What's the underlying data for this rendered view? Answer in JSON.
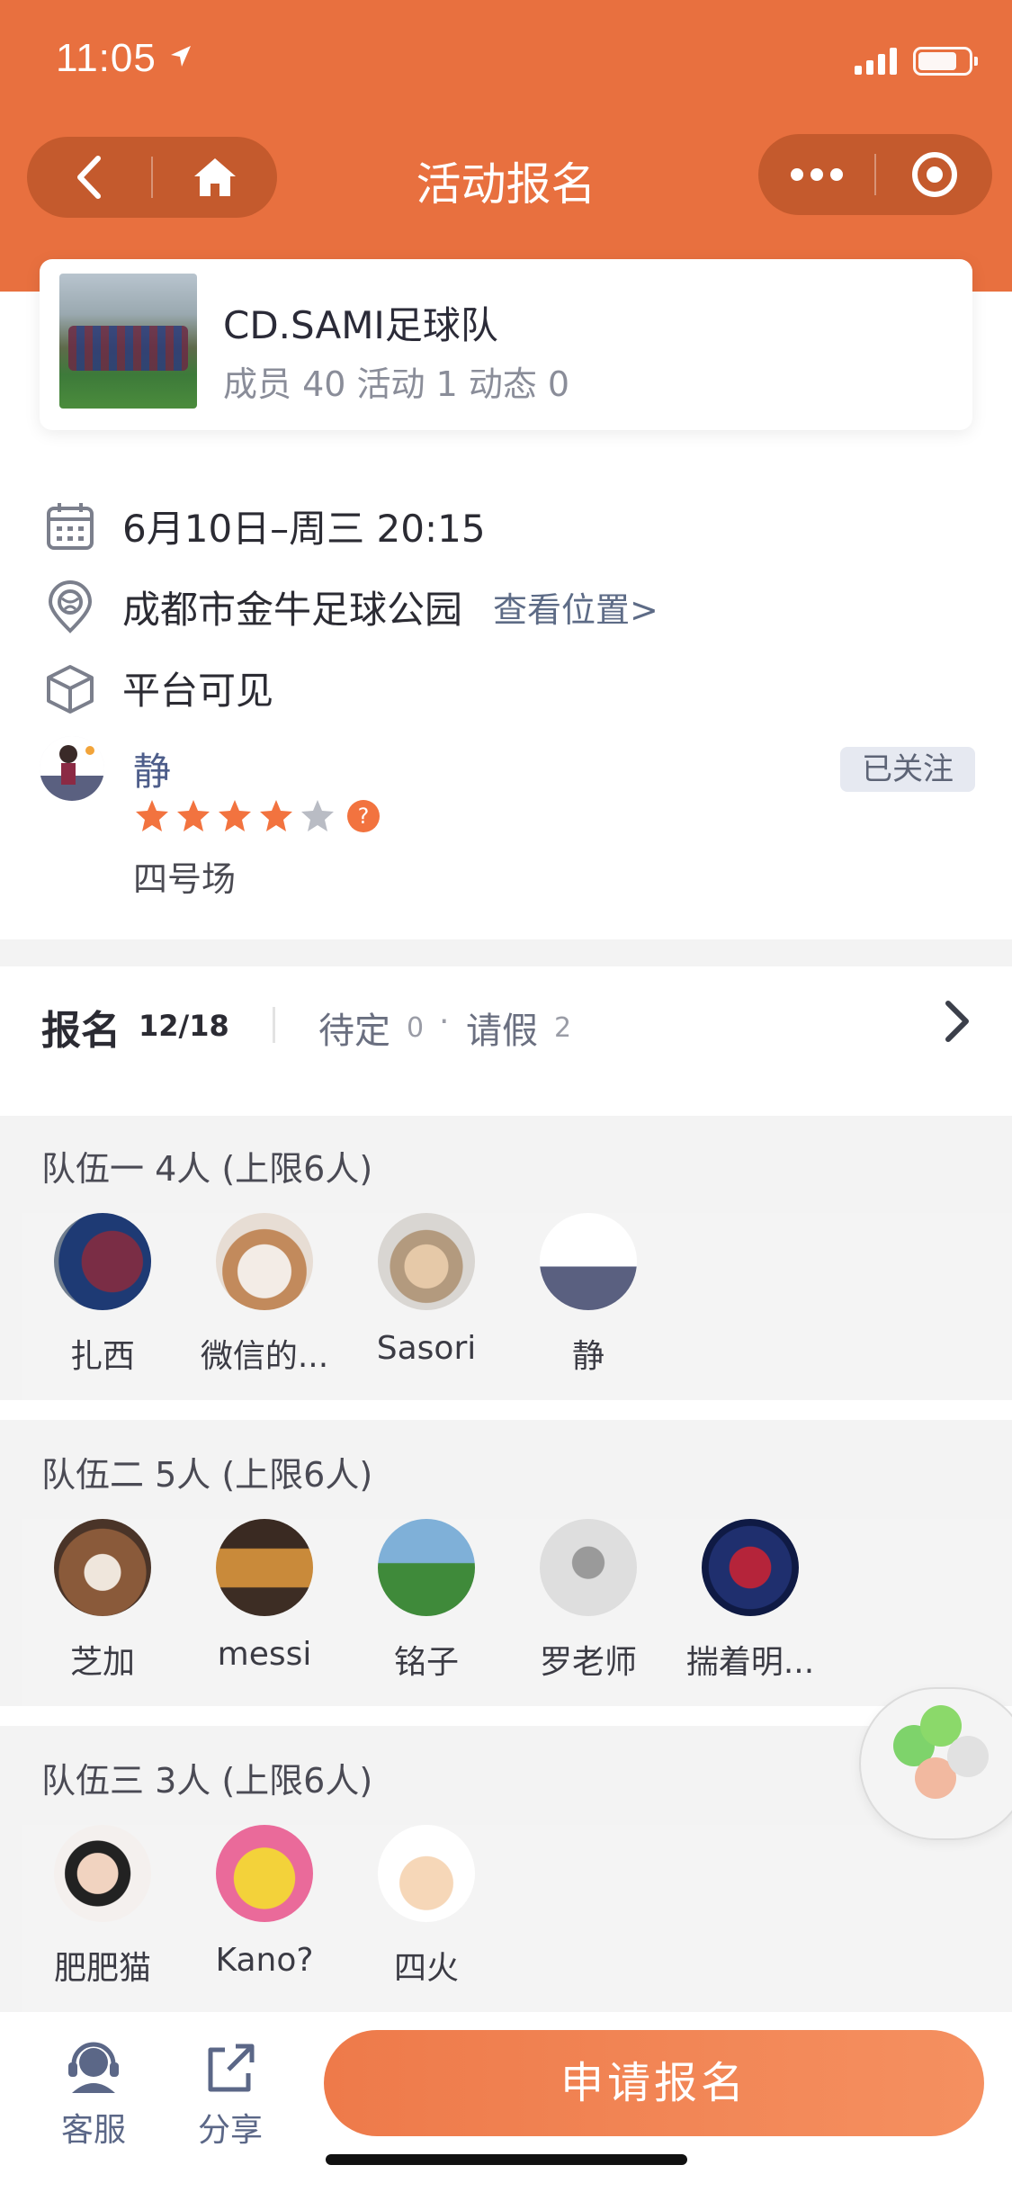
{
  "status_bar": {
    "time": "11:05"
  },
  "header": {
    "title": "活动报名"
  },
  "team": {
    "name": "CD.SAMI足球队",
    "stats": "成员 40 活动 1 动态 0"
  },
  "event": {
    "datetime": "6月10日–周三 20:15",
    "location": "成都市金牛足球公园",
    "location_link": "查看位置>",
    "visibility": "平台可见"
  },
  "host": {
    "name": "静",
    "rating": 4,
    "rating_max": 5,
    "note": "四号场",
    "follow_label": "已关注"
  },
  "colors": {
    "accent": "#e8703f",
    "star_on": "#f2733f",
    "star_off": "#b9bcc4",
    "link": "#5d6b86"
  },
  "signup": {
    "title": "报名",
    "count": "12/18",
    "pending_label": "待定",
    "pending_count": "0",
    "separator": "·",
    "leave_label": "请假",
    "leave_count": "2"
  },
  "teams": [
    {
      "heading": "队伍一 4人 (上限6人)",
      "members": [
        "扎西",
        "微信的...",
        "Sasori",
        "静"
      ]
    },
    {
      "heading": "队伍二 5人 (上限6人)",
      "members": [
        "芝加",
        "messi",
        "铭子",
        "罗老师",
        "揣着明..."
      ]
    },
    {
      "heading": "队伍三 3人 (上限6人)",
      "members": [
        "肥肥猫",
        "Kano?",
        "四火"
      ]
    }
  ],
  "bottom": {
    "service_label": "客服",
    "share_label": "分享",
    "apply_label": "申请报名"
  }
}
